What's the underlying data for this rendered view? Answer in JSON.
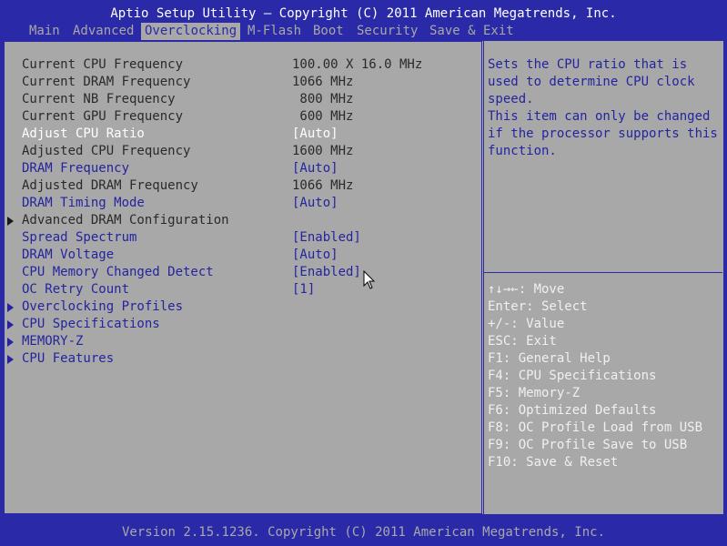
{
  "header": {
    "title": "Aptio Setup Utility – Copyright (C) 2011 American Megatrends, Inc."
  },
  "menu": {
    "items": [
      {
        "label": "Main"
      },
      {
        "label": "Advanced"
      },
      {
        "label": "Overclocking"
      },
      {
        "label": "M-Flash"
      },
      {
        "label": "Boot"
      },
      {
        "label": "Security"
      },
      {
        "label": "Save & Exit"
      }
    ]
  },
  "settings": [
    {
      "label": "Current CPU Frequency",
      "value": "100.00 X 16.0 MHz"
    },
    {
      "label": "Current DRAM Frequency",
      "value": "1066 MHz"
    },
    {
      "label": "Current NB Frequency",
      "value": " 800 MHz"
    },
    {
      "label": "Current GPU Frequency",
      "value": " 600 MHz"
    },
    {
      "label": "Adjust CPU Ratio",
      "value": "[Auto]"
    },
    {
      "label": "Adjusted CPU Frequency",
      "value": "1600 MHz"
    },
    {
      "label": "DRAM Frequency",
      "value": "[Auto]"
    },
    {
      "label": "Adjusted DRAM Frequency",
      "value": "1066 MHz"
    },
    {
      "label": "DRAM Timing Mode",
      "value": "[Auto]"
    },
    {
      "label": "Advanced DRAM Configuration",
      "value": ""
    },
    {
      "label": "Spread Spectrum",
      "value": "[Enabled]"
    },
    {
      "label": "DRAM Voltage",
      "value": "[Auto]"
    },
    {
      "label": "CPU Memory Changed Detect",
      "value": "[Enabled]"
    },
    {
      "label": "OC Retry Count",
      "value": "[1]"
    },
    {
      "label": "Overclocking Profiles",
      "value": ""
    },
    {
      "label": "CPU Specifications",
      "value": ""
    },
    {
      "label": "MEMORY-Z",
      "value": ""
    },
    {
      "label": "CPU Features",
      "value": ""
    }
  ],
  "help": {
    "text": "Sets the CPU ratio that is\nused to determine CPU clock\nspeed.\nThis item can only be changed\nif the processor supports this\nfunction."
  },
  "keys": [
    "↑↓→←: Move",
    "Enter: Select",
    "+/-: Value",
    "ESC: Exit",
    "F1: General Help",
    "F4: CPU Specifications",
    "F5: Memory-Z",
    "F6: Optimized Defaults",
    "F8: OC Profile Load from USB",
    "F9: OC Profile Save to USB",
    "F10: Save & Reset"
  ],
  "footer": {
    "text": "Version 2.15.1236. Copyright (C) 2011 American Megatrends, Inc."
  },
  "colors": {
    "background": "#2a2aa8",
    "panel": "#a8a8a8",
    "highlight": "#ffffff",
    "editable": "#2424a0"
  }
}
